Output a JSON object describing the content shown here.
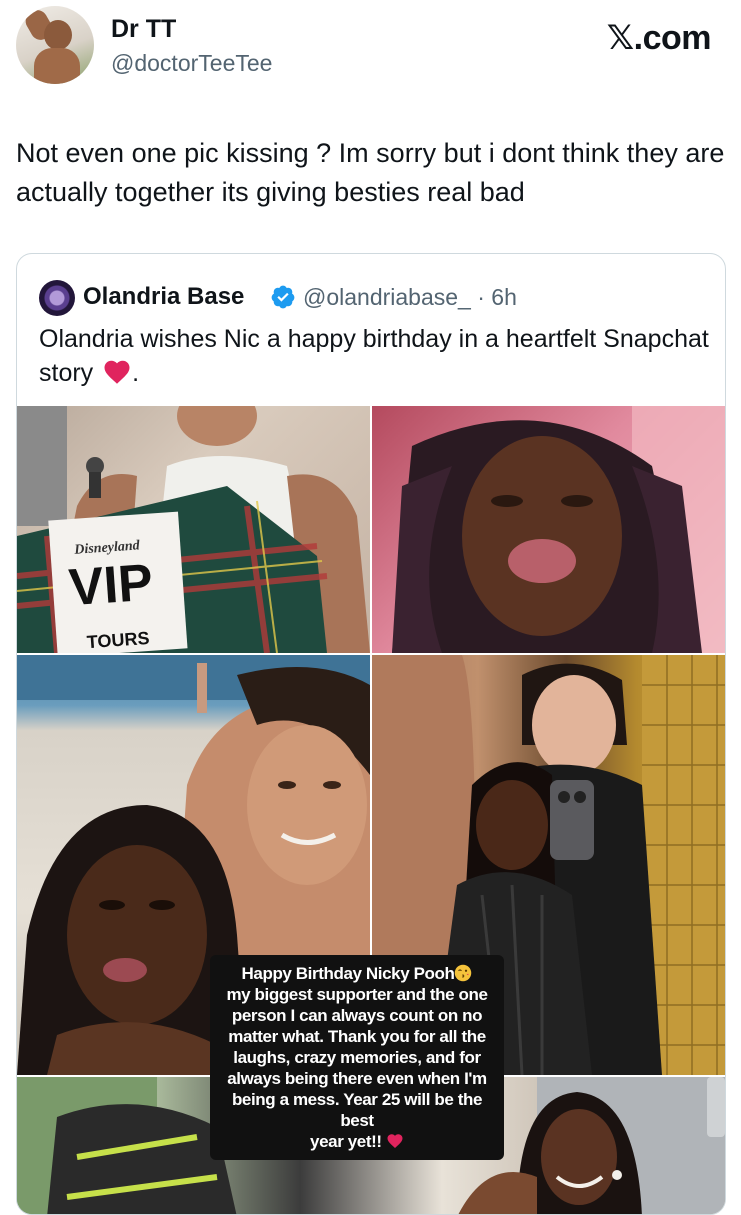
{
  "header": {
    "display_name": "Dr TT",
    "handle": "@doctorTeeTee",
    "brand": "𝕏.com"
  },
  "tweet": {
    "text": "Not even one pic kissing ? Im sorry but i dont think they are actually together its giving besties real bad"
  },
  "quoted_tweet": {
    "name": "Olandria Base",
    "handle_time": "@olandriabase_ · 6h",
    "text": "Olandria wishes Nic a happy birthday in a heartfelt Snapchat story",
    "text_suffix": ".",
    "heart_color": "#e0245e",
    "verified_color": "#1d9bf0",
    "photo_text": {
      "brand": "Disneyland",
      "badge": "VIP",
      "sub": "TOURS"
    },
    "caption_lines": [
      "Happy Birthday Nicky Pooh",
      "my biggest supporter and the one",
      "person I can always count on no",
      "matter what. Thank you for all the",
      "laughs, crazy memories, and for",
      "always being there even when I'm",
      "being a mess. Year 25 will be the best",
      "year yet!!"
    ]
  },
  "colors": {
    "text_primary": "#0f1419",
    "text_secondary": "#536471",
    "border": "#cfd9de"
  }
}
